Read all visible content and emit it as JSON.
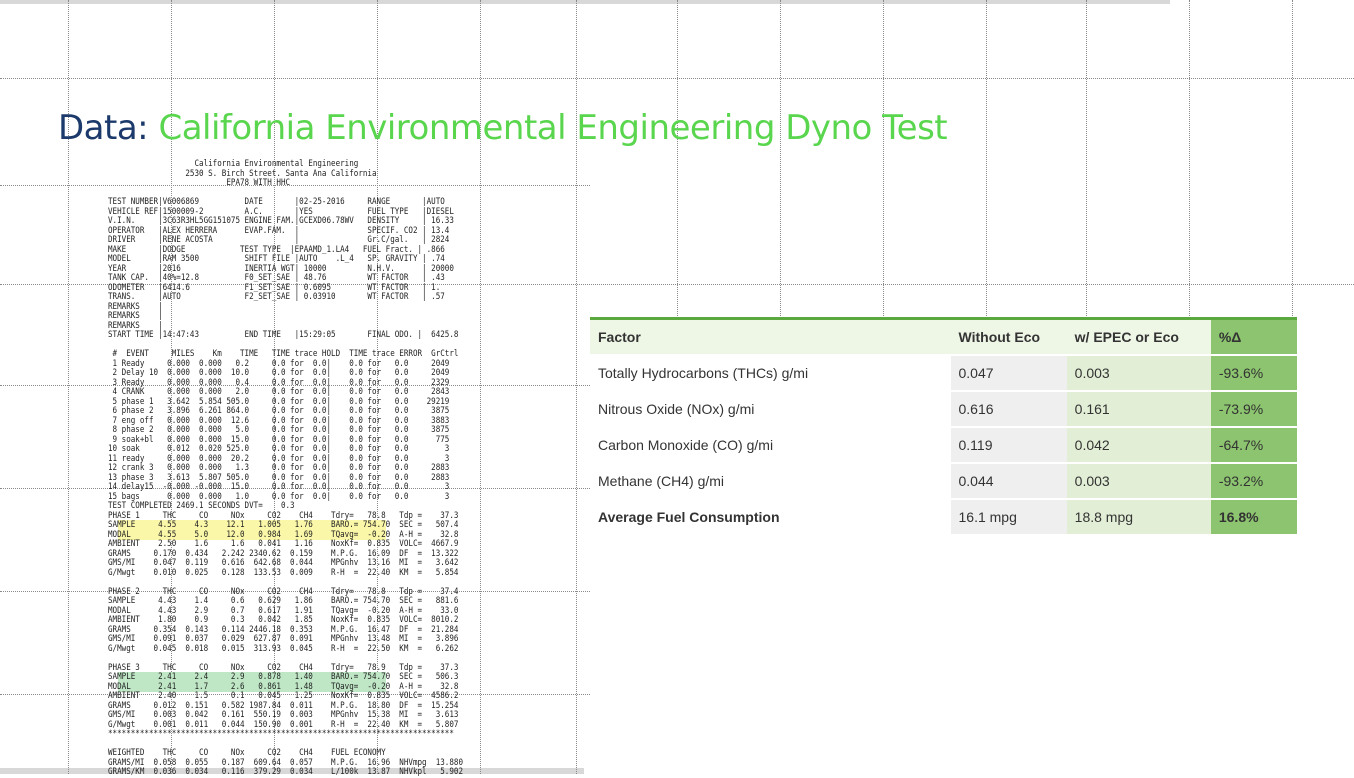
{
  "title": {
    "label": "Data:",
    "text": "California Environmental Engineering Dyno Test"
  },
  "report": {
    "lines": [
      "                   California Environmental Engineering",
      "                 2530 S. Birch Street. Santa Ana California",
      "                          EPA78 WITH HHC",
      "",
      "TEST NUMBER|V6006869          DATE       |02-25-2016     RANGE       |AUTO",
      "VEHICLE REF|1500009-2         A.C.       |YES            FUEL TYPE   |DIESEL",
      "V.I.N.     |3C63R3HL5GG151075 ENGINE FAM.|GCEXD06.78WV   DENSITY     | 16.33",
      "OPERATOR   |ALEX HERRERA      EVAP.FAM.  |               SPECIF. CO2 | 13.4",
      "DRIVER     |RENE ACOSTA                  |               Gr.C/gal.   | 2824",
      "MAKE       |DODGE            TEST TYPE  |EPAAMD_1.LA4   FUEL Fract. | .866",
      "MODEL      |RAM 3500          SHIFT FILE |AUTO    .L_4   SP. GRAVITY | .74",
      "YEAR       |2016              INERTIA WGT| 10000         N.H.V.      | 20000",
      "TANK CAP.  |40%=12.8          F0_SET_SAE | 48.76         WT FACTOR   | .43",
      "ODOMETER   |6414.6            F1_SET_SAE | 0.6095        WT FACTOR   | 1.",
      "TRANS.     |AUTO              F2_SET_SAE | 0.03910       WT FACTOR   | .57",
      "REMARKS    |",
      "REMARKS    |",
      "REMARKS    |",
      "START TIME |14:47:43          END TIME   |15:29:05       FINAL ODO. |  6425.8",
      "",
      " #  EVENT     MILES    Km    TIME   TIME trace HOLD  TIME trace ERROR  GrCtrl",
      " 1 Ready     0.000  0.000   0.2     0.0 for  0.0|    0.0 for   0.0     2049",
      " 2 Delay 10  0.000  0.000  10.0     0.0 for  0.0|    0.0 for   0.0     2049",
      " 3 Ready     0.000  0.000   0.4     0.0 for  0.0|    0.0 for   0.0     2329",
      " 4 CRANK     0.000  0.000   2.0     0.0 for  0.0|    0.0 for   0.0     2843",
      " 5 phase 1   3.642  5.854 505.0     0.0 for  0.0|    0.0 for   0.0    29219",
      " 6 phase 2   3.896  6.261 864.0     0.0 for  0.0|    0.0 for   0.0     3875",
      " 7 eng off   0.000  0.000  12.6     0.0 for  0.0|    0.0 for   0.0     3883",
      " 8 phase 2   0.000  0.000   5.0     0.0 for  0.0|    0.0 for   0.0     3875",
      " 9 soak+bl   0.000  0.000  15.0     0.0 for  0.0|    0.0 for   0.0      775",
      "10 soak      0.012  0.020 525.0     0.0 for  0.0|    0.0 for   0.0        3",
      "11 ready     0.000  0.000  20.2     0.0 for  0.0|    0.0 for   0.0        3",
      "12 crank 3   0.000  0.000   1.3     0.0 for  0.0|    0.0 for   0.0     2883",
      "13 phase 3   3.613  5.807 505.0     0.0 for  0.0|    0.0 for   0.0     2883",
      "14 delay15  -0.000 -0.000  15.0     0.0 for  0.0|    0.0 for   0.0        3",
      "15 bags      0.000  0.000   1.0     0.0 for  0.0|    0.0 for   0.0        3",
      "TEST COMPLETED 2469.1 SECONDS DVT=    0.3",
      "PHASE 1     THC     CO     NOx     CO2    CH4    Tdry=   78.8   Tdp =    37.3",
      "SAMPLE     4.55    4.3    12.1   1.005   1.76    BARO.= 754.70  SEC =   507.4",
      "MODAL      4.55    5.0    12.0   0.984   1.69    TQavg=  -0.20  A-H =    32.8",
      "AMBIENT    2.50    1.6     1.6   0.041   1.16    NoxKf=  0.835  VOLC=  4667.9",
      "GRAMS     0.170  0.434   2.242 2340.62  0.159    M.P.G.  16.09  DF  =  13.322",
      "GMS/MI    0.047  0.119   0.616  642.68  0.044    MPGnhv  13.16  MI  =   3.642",
      "G/Mwgt    0.010  0.025   0.128  133.53  0.009    R-H  =  22.40  KM  =   5.854",
      "",
      "PHASE 2     THC     CO     NOx     CO2    CH4    Tdry=   78.8   Tdp =    37.4",
      "SAMPLE     4.43    1.4     0.6   0.629   1.86    BARO.= 754.70  SEC =   881.6",
      "MODAL      4.43    2.9     0.7   0.617   1.91    TQavg=  -0.20  A-H =    33.0",
      "AMBIENT    1.80    0.9     0.3   0.042   1.85    NoxKf=  0.835  VOLC=  8010.2",
      "GRAMS     0.354  0.143   0.114 2446.18  0.353    M.P.G.  16.47  DF  =  21.284",
      "GMS/MI    0.091  0.037   0.029  627.87  0.091    MPGnhv  13.48  MI  =   3.896",
      "G/Mwgt    0.045  0.018   0.015  313.93  0.045    R-H  =  22.50  KM  =   6.262",
      "",
      "PHASE 3     THC     CO     NOx     CO2    CH4    Tdry=   78.9   Tdp =    37.3",
      "SAMPLE     2.41    2.4     2.9   0.878   1.40    BARO.= 754.70  SEC =   506.3",
      "MODAL      2.41    1.7     2.6   0.861   1.48    TQavg=  -0.20  A-H =    32.8",
      "AMBIENT    2.40    1.5     0.1   0.045   1.25    NoxKf=  0.835  VOLC=  4586.2",
      "GRAMS     0.012  0.151   0.582 1987.84  0.011    M.P.G.  18.80  DF  =  15.254",
      "GMS/MI    0.003  0.042   0.161  550.19  0.003    MPGnhv  15.38  MI  =   3.613",
      "G/Mwgt    0.001  0.011   0.044  150.90  0.001    R-H  =  22.40  KM  =   5.807",
      "****************************************************************************",
      "",
      "WEIGHTED    THC     CO     NOx     CO2    CH4    FUEL ECONOMY",
      "GRAMS/MI  0.058  0.055   0.187  609.64  0.057    M.P.G.  16.96  NHVmpg  13.880",
      "GRAMS/KM  0.036  0.034   0.116  379.29  0.034    L/100k  13.87  NHVkpl   5.902"
    ]
  },
  "factor_table": {
    "headers": [
      "Factor",
      "Without Eco",
      "w/ EPEC or Eco",
      "%Δ"
    ],
    "rows": [
      [
        "Totally Hydrocarbons (THCs) g/mi",
        "0.047",
        "0.003",
        "-93.6%"
      ],
      [
        "Nitrous Oxide (NOx) g/mi",
        "0.616",
        "0.161",
        "-73.9%"
      ],
      [
        "Carbon Monoxide (CO) g/mi",
        "0.119",
        "0.042",
        "-64.7%"
      ],
      [
        "Methane (CH4) g/mi",
        "0.044",
        "0.003",
        "-93.2%"
      ],
      [
        "Average Fuel Consumption",
        "16.1 mpg",
        "18.8 mpg",
        "16.8%"
      ]
    ]
  },
  "colors": {
    "title_label": "#1b3a6b",
    "title_text": "#5ad64e",
    "highlight_yellow": "#fbf7a8",
    "highlight_green": "#bfe7c6",
    "delta_green": "#8cc46f"
  }
}
